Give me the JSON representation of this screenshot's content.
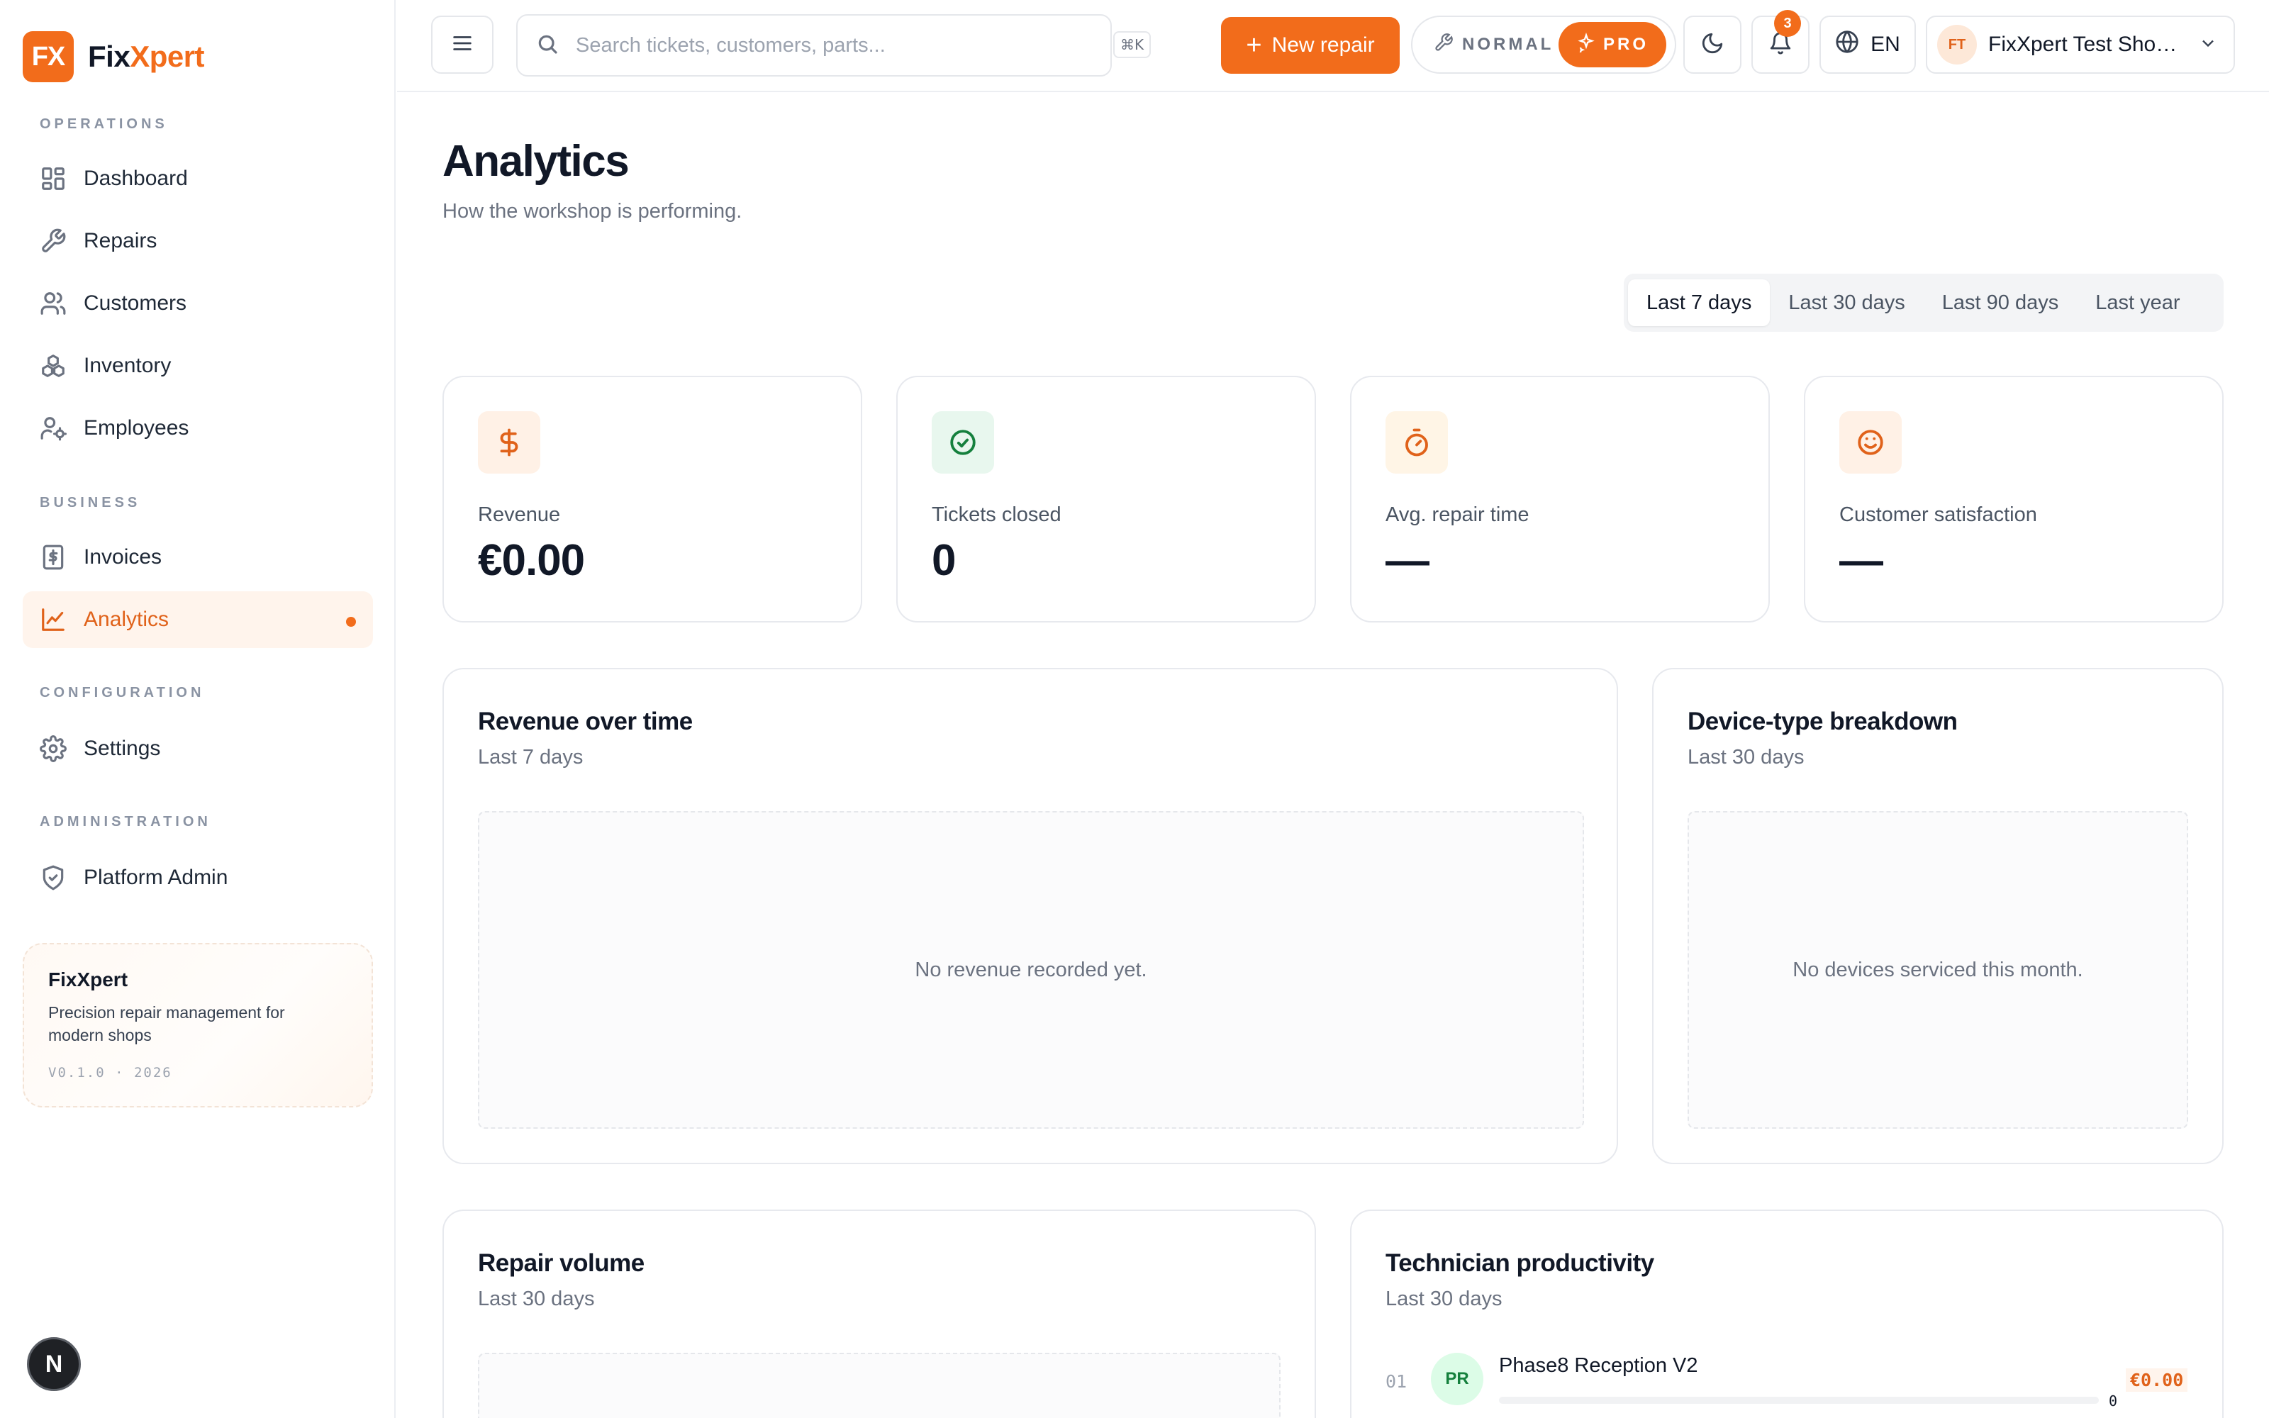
{
  "brand": {
    "logo": "FX",
    "name_part1": "Fix",
    "name_part2": "Xpert",
    "accent_color": "#f26c1b"
  },
  "sidebar": {
    "sections": {
      "operations": "OPERATIONS",
      "business": "BUSINESS",
      "configuration": "CONFIGURATION",
      "administration": "ADMINISTRATION"
    },
    "items": [
      {
        "label": "Dashboard",
        "icon": "dashboard-icon"
      },
      {
        "label": "Repairs",
        "icon": "wrench-icon"
      },
      {
        "label": "Customers",
        "icon": "users-icon"
      },
      {
        "label": "Inventory",
        "icon": "boxes-icon"
      },
      {
        "label": "Employees",
        "icon": "user-cog-icon"
      },
      {
        "label": "Invoices",
        "icon": "receipt-icon"
      },
      {
        "label": "Analytics",
        "icon": "line-chart-icon",
        "active": true
      },
      {
        "label": "Settings",
        "icon": "gear-icon"
      },
      {
        "label": "Platform Admin",
        "icon": "shield-check-icon"
      }
    ],
    "promo": {
      "title": "FixXpert",
      "description": "Precision repair management for modern shops",
      "version": "V0.1.0 · 2026"
    },
    "next_badge": "N"
  },
  "topbar": {
    "search_placeholder": "Search tickets, customers, parts...",
    "shortcut": "⌘K",
    "new_repair_label": "New repair",
    "mode_normal_label": "NORMAL",
    "mode_pro_label": "PRO",
    "notification_count": "3",
    "language": "EN",
    "account_initials": "FT",
    "account_name": "FixXpert Test Shop ..."
  },
  "main": {
    "title": "Analytics",
    "subtitle": "How the workshop is performing.",
    "ranges": [
      "Last 7 days",
      "Last 30 days",
      "Last 90 days",
      "Last year"
    ],
    "active_range": "Last 7 days",
    "stats": [
      {
        "label": "Revenue",
        "value": "€0.00",
        "icon": "dollar-icon",
        "tint": "#fff1e6",
        "color": "#e0621a"
      },
      {
        "label": "Tickets closed",
        "value": "0",
        "icon": "check-circle-icon",
        "tint": "#e8f7ee",
        "color": "#15803d"
      },
      {
        "label": "Avg. repair time",
        "value": "—",
        "icon": "timer-icon",
        "tint": "#fff5e6",
        "color": "#e0621a"
      },
      {
        "label": "Customer satisfaction",
        "value": "—",
        "icon": "smile-icon",
        "tint": "#fff1e6",
        "color": "#e0621a"
      }
    ],
    "revenue_panel": {
      "title": "Revenue over time",
      "subtitle": "Last 7 days",
      "empty": "No revenue recorded yet."
    },
    "device_panel": {
      "title": "Device-type breakdown",
      "subtitle": "Last 30 days",
      "empty": "No devices serviced this month."
    },
    "volume_panel": {
      "title": "Repair volume",
      "subtitle": "Last 30 days"
    },
    "tech_panel": {
      "title": "Technician productivity",
      "subtitle": "Last 30 days",
      "rows": [
        {
          "rank": "01",
          "initials": "PR",
          "name": "Phase8 Reception V2",
          "count": "0",
          "revenue": "€0.00"
        }
      ]
    }
  }
}
